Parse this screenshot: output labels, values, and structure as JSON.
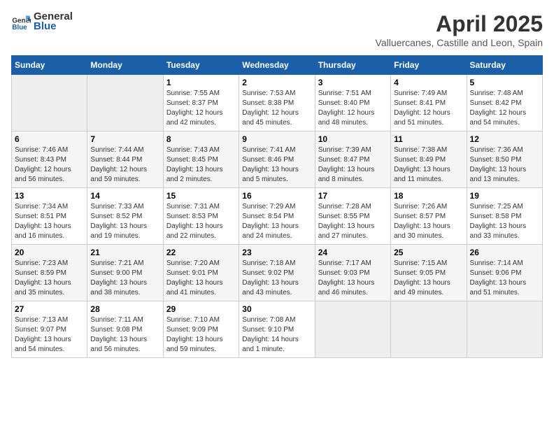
{
  "header": {
    "logo_general": "General",
    "logo_blue": "Blue",
    "title": "April 2025",
    "subtitle": "Valluercanes, Castille and Leon, Spain"
  },
  "days_of_week": [
    "Sunday",
    "Monday",
    "Tuesday",
    "Wednesday",
    "Thursday",
    "Friday",
    "Saturday"
  ],
  "weeks": [
    [
      {
        "day": "",
        "sunrise": "",
        "sunset": "",
        "daylight": "",
        "empty": true
      },
      {
        "day": "",
        "sunrise": "",
        "sunset": "",
        "daylight": "",
        "empty": true
      },
      {
        "day": "1",
        "sunrise": "Sunrise: 7:55 AM",
        "sunset": "Sunset: 8:37 PM",
        "daylight": "Daylight: 12 hours and 42 minutes."
      },
      {
        "day": "2",
        "sunrise": "Sunrise: 7:53 AM",
        "sunset": "Sunset: 8:38 PM",
        "daylight": "Daylight: 12 hours and 45 minutes."
      },
      {
        "day": "3",
        "sunrise": "Sunrise: 7:51 AM",
        "sunset": "Sunset: 8:40 PM",
        "daylight": "Daylight: 12 hours and 48 minutes."
      },
      {
        "day": "4",
        "sunrise": "Sunrise: 7:49 AM",
        "sunset": "Sunset: 8:41 PM",
        "daylight": "Daylight: 12 hours and 51 minutes."
      },
      {
        "day": "5",
        "sunrise": "Sunrise: 7:48 AM",
        "sunset": "Sunset: 8:42 PM",
        "daylight": "Daylight: 12 hours and 54 minutes."
      }
    ],
    [
      {
        "day": "6",
        "sunrise": "Sunrise: 7:46 AM",
        "sunset": "Sunset: 8:43 PM",
        "daylight": "Daylight: 12 hours and 56 minutes."
      },
      {
        "day": "7",
        "sunrise": "Sunrise: 7:44 AM",
        "sunset": "Sunset: 8:44 PM",
        "daylight": "Daylight: 12 hours and 59 minutes."
      },
      {
        "day": "8",
        "sunrise": "Sunrise: 7:43 AM",
        "sunset": "Sunset: 8:45 PM",
        "daylight": "Daylight: 13 hours and 2 minutes."
      },
      {
        "day": "9",
        "sunrise": "Sunrise: 7:41 AM",
        "sunset": "Sunset: 8:46 PM",
        "daylight": "Daylight: 13 hours and 5 minutes."
      },
      {
        "day": "10",
        "sunrise": "Sunrise: 7:39 AM",
        "sunset": "Sunset: 8:47 PM",
        "daylight": "Daylight: 13 hours and 8 minutes."
      },
      {
        "day": "11",
        "sunrise": "Sunrise: 7:38 AM",
        "sunset": "Sunset: 8:49 PM",
        "daylight": "Daylight: 13 hours and 11 minutes."
      },
      {
        "day": "12",
        "sunrise": "Sunrise: 7:36 AM",
        "sunset": "Sunset: 8:50 PM",
        "daylight": "Daylight: 13 hours and 13 minutes."
      }
    ],
    [
      {
        "day": "13",
        "sunrise": "Sunrise: 7:34 AM",
        "sunset": "Sunset: 8:51 PM",
        "daylight": "Daylight: 13 hours and 16 minutes."
      },
      {
        "day": "14",
        "sunrise": "Sunrise: 7:33 AM",
        "sunset": "Sunset: 8:52 PM",
        "daylight": "Daylight: 13 hours and 19 minutes."
      },
      {
        "day": "15",
        "sunrise": "Sunrise: 7:31 AM",
        "sunset": "Sunset: 8:53 PM",
        "daylight": "Daylight: 13 hours and 22 minutes."
      },
      {
        "day": "16",
        "sunrise": "Sunrise: 7:29 AM",
        "sunset": "Sunset: 8:54 PM",
        "daylight": "Daylight: 13 hours and 24 minutes."
      },
      {
        "day": "17",
        "sunrise": "Sunrise: 7:28 AM",
        "sunset": "Sunset: 8:55 PM",
        "daylight": "Daylight: 13 hours and 27 minutes."
      },
      {
        "day": "18",
        "sunrise": "Sunrise: 7:26 AM",
        "sunset": "Sunset: 8:57 PM",
        "daylight": "Daylight: 13 hours and 30 minutes."
      },
      {
        "day": "19",
        "sunrise": "Sunrise: 7:25 AM",
        "sunset": "Sunset: 8:58 PM",
        "daylight": "Daylight: 13 hours and 33 minutes."
      }
    ],
    [
      {
        "day": "20",
        "sunrise": "Sunrise: 7:23 AM",
        "sunset": "Sunset: 8:59 PM",
        "daylight": "Daylight: 13 hours and 35 minutes."
      },
      {
        "day": "21",
        "sunrise": "Sunrise: 7:21 AM",
        "sunset": "Sunset: 9:00 PM",
        "daylight": "Daylight: 13 hours and 38 minutes."
      },
      {
        "day": "22",
        "sunrise": "Sunrise: 7:20 AM",
        "sunset": "Sunset: 9:01 PM",
        "daylight": "Daylight: 13 hours and 41 minutes."
      },
      {
        "day": "23",
        "sunrise": "Sunrise: 7:18 AM",
        "sunset": "Sunset: 9:02 PM",
        "daylight": "Daylight: 13 hours and 43 minutes."
      },
      {
        "day": "24",
        "sunrise": "Sunrise: 7:17 AM",
        "sunset": "Sunset: 9:03 PM",
        "daylight": "Daylight: 13 hours and 46 minutes."
      },
      {
        "day": "25",
        "sunrise": "Sunrise: 7:15 AM",
        "sunset": "Sunset: 9:05 PM",
        "daylight": "Daylight: 13 hours and 49 minutes."
      },
      {
        "day": "26",
        "sunrise": "Sunrise: 7:14 AM",
        "sunset": "Sunset: 9:06 PM",
        "daylight": "Daylight: 13 hours and 51 minutes."
      }
    ],
    [
      {
        "day": "27",
        "sunrise": "Sunrise: 7:13 AM",
        "sunset": "Sunset: 9:07 PM",
        "daylight": "Daylight: 13 hours and 54 minutes."
      },
      {
        "day": "28",
        "sunrise": "Sunrise: 7:11 AM",
        "sunset": "Sunset: 9:08 PM",
        "daylight": "Daylight: 13 hours and 56 minutes."
      },
      {
        "day": "29",
        "sunrise": "Sunrise: 7:10 AM",
        "sunset": "Sunset: 9:09 PM",
        "daylight": "Daylight: 13 hours and 59 minutes."
      },
      {
        "day": "30",
        "sunrise": "Sunrise: 7:08 AM",
        "sunset": "Sunset: 9:10 PM",
        "daylight": "Daylight: 14 hours and 1 minute."
      },
      {
        "day": "",
        "sunrise": "",
        "sunset": "",
        "daylight": "",
        "empty": true
      },
      {
        "day": "",
        "sunrise": "",
        "sunset": "",
        "daylight": "",
        "empty": true
      },
      {
        "day": "",
        "sunrise": "",
        "sunset": "",
        "daylight": "",
        "empty": true
      }
    ]
  ]
}
